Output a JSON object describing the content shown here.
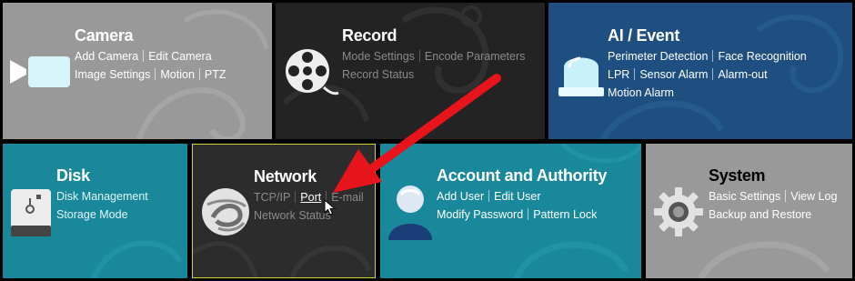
{
  "tiles": {
    "camera": {
      "title": "Camera",
      "row1": [
        "Add Camera",
        "Edit Camera"
      ],
      "row2": [
        "Image Settings",
        "Motion",
        "PTZ"
      ],
      "icon": "video-camera-icon"
    },
    "record": {
      "title": "Record",
      "row1": [
        "Mode Settings",
        "Encode Parameters"
      ],
      "row2": [
        "Record Status"
      ],
      "icon": "film-reel-icon"
    },
    "ai": {
      "title": "AI / Event",
      "row1": [
        "Perimeter Detection",
        "Face Recognition"
      ],
      "row2": [
        "LPR",
        "Sensor Alarm",
        "Alarm-out"
      ],
      "row3": [
        "Motion Alarm"
      ],
      "icon": "alarm-light-icon"
    },
    "disk": {
      "title": "Disk",
      "row1": [
        "Disk Management"
      ],
      "row2": [
        "Storage Mode"
      ],
      "icon": "hard-disk-icon"
    },
    "network": {
      "title": "Network",
      "row1": [
        "TCP/IP",
        "Port",
        "E-mail"
      ],
      "row2": [
        "Network Status"
      ],
      "icon": "network-globe-icon"
    },
    "account": {
      "title": "Account and Authority",
      "row1": [
        "Add User",
        "Edit User"
      ],
      "row2": [
        "Modify Password",
        "Pattern Lock"
      ],
      "icon": "user-icon"
    },
    "system": {
      "title": "System",
      "row1": [
        "Basic Settings",
        "View Log"
      ],
      "row2": [
        "Backup and Restore"
      ],
      "icon": "gear-icon"
    }
  },
  "colors": {
    "camera_bg": "#9a999a",
    "record_bg": "#232323",
    "ai_bg": "#1e4f80",
    "teal_bg": "#19889a",
    "network_bg": "#2c2c2c",
    "network_border": "#d8d23a",
    "annotation_arrow": "#e8141b"
  }
}
